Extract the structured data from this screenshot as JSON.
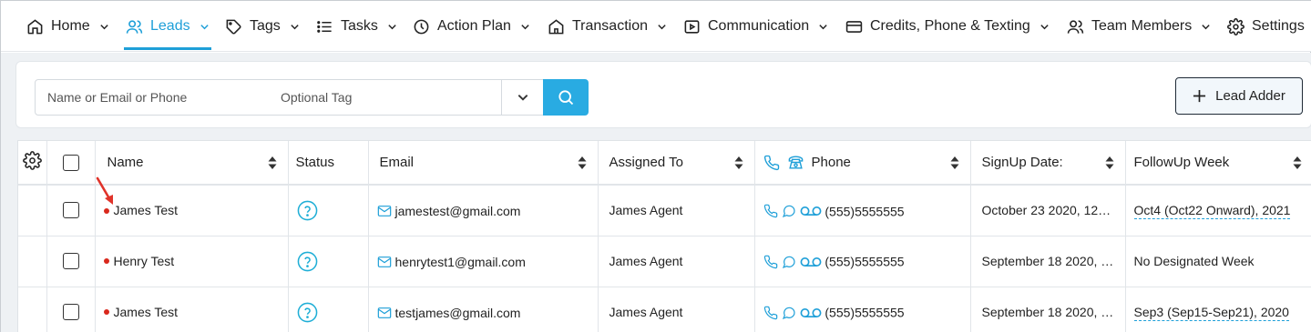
{
  "nav": {
    "items": [
      {
        "label": "Home",
        "icon": "home-icon"
      },
      {
        "label": "Leads",
        "icon": "users-icon",
        "active": true
      },
      {
        "label": "Tags",
        "icon": "tag-icon"
      },
      {
        "label": "Tasks",
        "icon": "list-icon"
      },
      {
        "label": "Action Plan",
        "icon": "clock-icon"
      },
      {
        "label": "Transaction",
        "icon": "house-icon"
      },
      {
        "label": "Communication",
        "icon": "video-icon"
      },
      {
        "label": "Credits, Phone & Texting",
        "icon": "card-icon"
      },
      {
        "label": "Team Members",
        "icon": "team-icon"
      },
      {
        "label": "Settings",
        "icon": "gear-icon"
      }
    ],
    "accent": "#1e9fd8"
  },
  "search": {
    "name_placeholder": "Name or Email or Phone",
    "tag_placeholder": "Optional Tag",
    "search_button_color": "#29abe2"
  },
  "lead_adder": {
    "label": "Lead Adder"
  },
  "table": {
    "headers": {
      "name": "Name",
      "status": "Status",
      "email": "Email",
      "assigned": "Assigned To",
      "phone": "Phone",
      "signup": "SignUp Date:",
      "followup": "FollowUp Week"
    },
    "rows": [
      {
        "name": "James Test",
        "email": "jamestest@gmail.com",
        "assigned": "James Agent",
        "phone": "(555)5555555",
        "signup": "October 23 2020, 12:5...",
        "followup": "Oct4 (Oct22 Onward), 2021",
        "followup_link": true
      },
      {
        "name": "Henry Test",
        "email": "henrytest1@gmail.com",
        "assigned": "James Agent",
        "phone": "(555)5555555",
        "signup": "September 18 2020, 1:...",
        "followup": "No Designated Week",
        "followup_link": false
      },
      {
        "name": "James Test",
        "email": "testjames@gmail.com",
        "assigned": "James Agent",
        "phone": "(555)5555555",
        "signup": "September 18 2020, 1:...",
        "followup": "Sep3 (Sep15-Sep21), 2020",
        "followup_link": true
      }
    ]
  }
}
